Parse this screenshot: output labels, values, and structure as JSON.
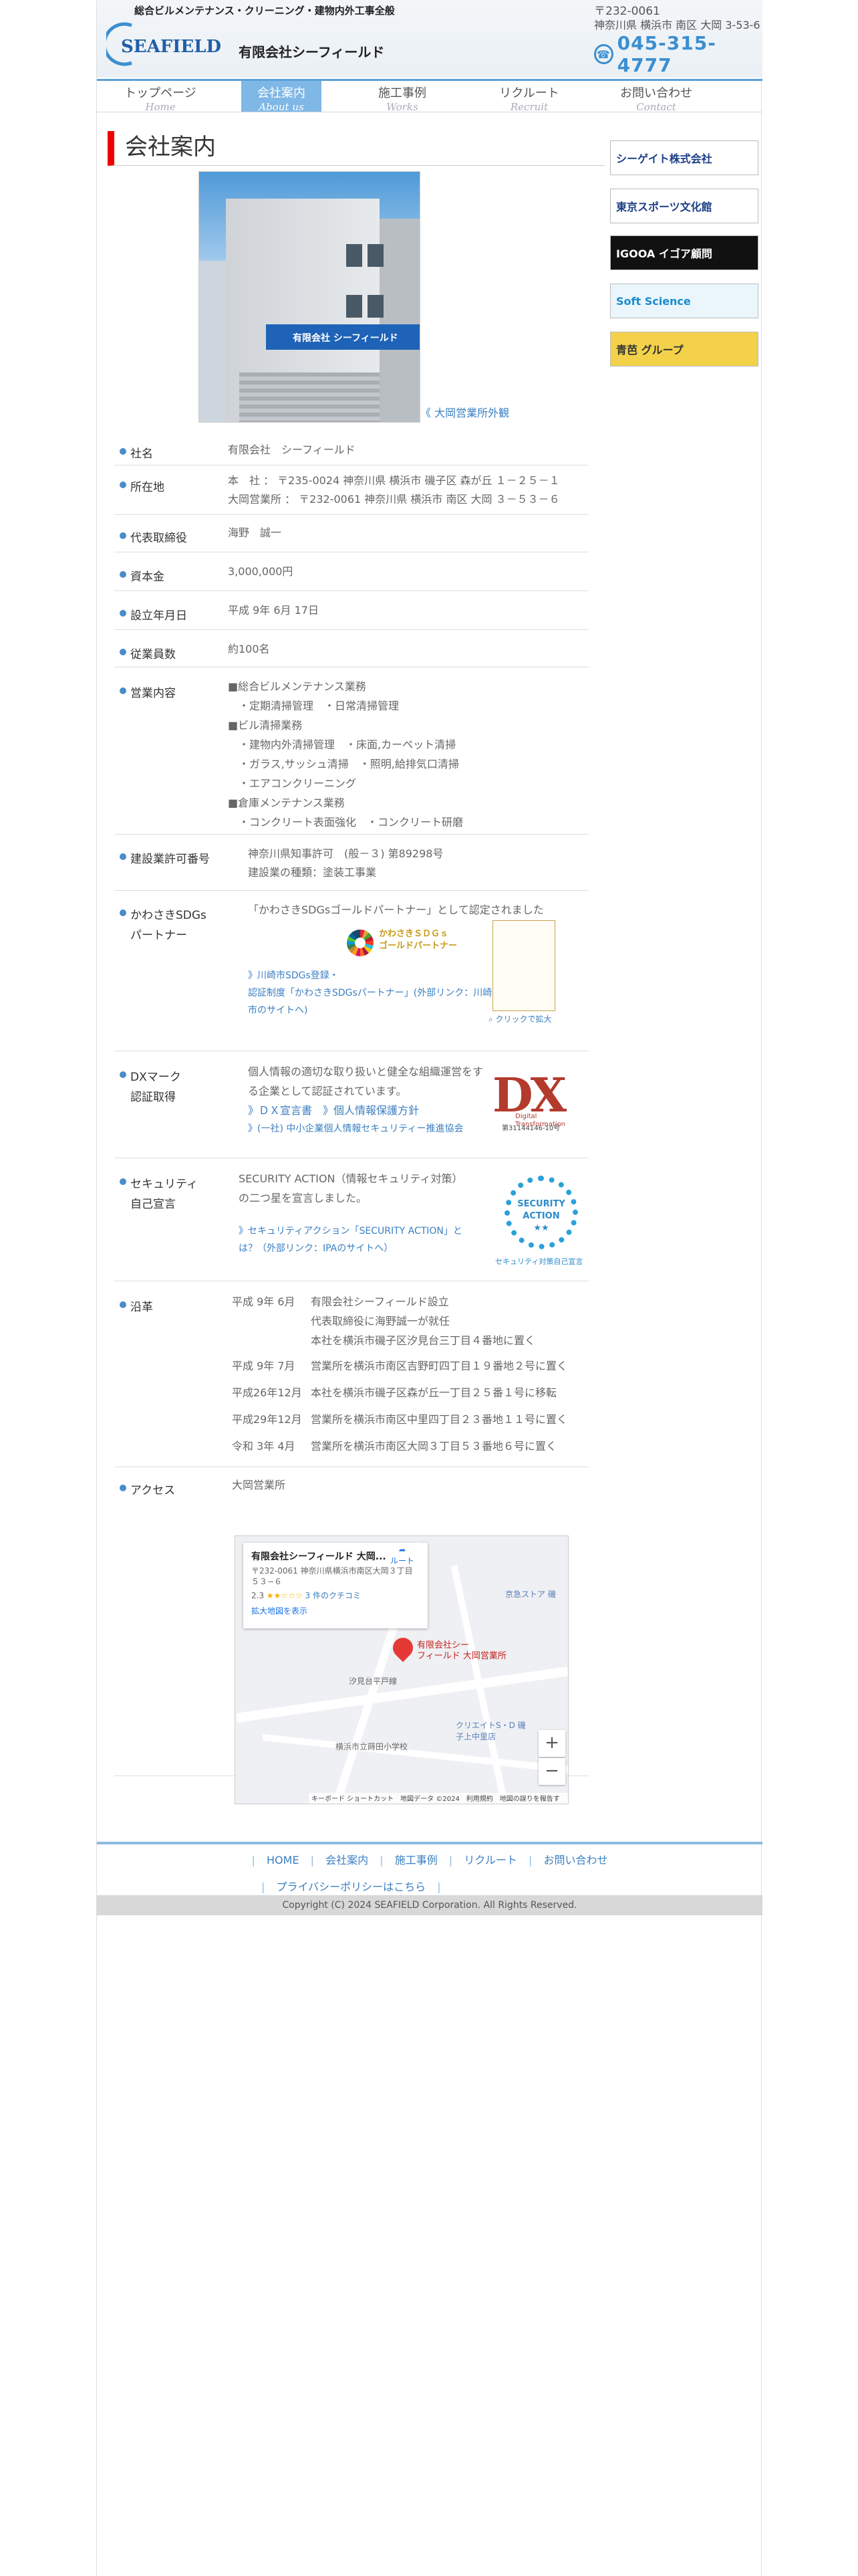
{
  "header": {
    "tagline": "総合ビルメンテナンス・クリーニング・建物内外工事全般",
    "logo_text": "SEAFIELD",
    "company_name": "有限会社シーフィールド",
    "zip": "〒232-0061",
    "address": "神奈川県 横浜市 南区 大岡 3-53-6",
    "phone": "045-315-4777"
  },
  "nav": [
    {
      "jp": "トップページ",
      "en": "Home"
    },
    {
      "jp": "会社案内",
      "en": "About us"
    },
    {
      "jp": "施工事例",
      "en": "Works"
    },
    {
      "jp": "リクルート",
      "en": "Recruit"
    },
    {
      "jp": "お問い合わせ",
      "en": "Contact"
    }
  ],
  "page_title": "会社案内",
  "building": {
    "sign_text": "有限会社 シーフィールド",
    "caption": "《 大岡営業所外観"
  },
  "info": {
    "name_label": "社名",
    "name_value": "有限会社　シーフィールド",
    "location_label": "所在地",
    "location_1": "本　社 ： 〒235-0024 神奈川県 横浜市 磯子区 森が丘 １－２５－１",
    "location_2": "大岡営業所 ： 〒232-0061 神奈川県 横浜市 南区 大岡 ３－５３－６",
    "rep_label": "代表取締役",
    "rep_value": "海野　誠一",
    "capital_label": "資本金",
    "capital_value": "3,000,000円",
    "founded_label": "設立年月日",
    "founded_value": "平成 9年 6月 17日",
    "staff_label": "従業員数",
    "staff_value": "約100名",
    "business_label": "営業内容",
    "business_lines": [
      "■総合ビルメンテナンス業務",
      "　・定期清掃管理　・日常清掃管理",
      "■ビル清掃業務",
      "　・建物内外清掃管理　・床面,カーペット清掃",
      "　・ガラス,サッシュ清掃　・照明,給排気口清掃",
      "　・エアコンクリーニング",
      "■倉庫メンテナンス業務",
      "　・コンクリート表面強化　・コンクリート研磨"
    ],
    "license_label": "建設業許可番号",
    "license_1": "神奈川県知事許可　(般－３) 第89298号",
    "license_2": "建設業の種類：塗装工事業",
    "sdgs_label_1": "かわさきSDGs",
    "sdgs_label_2": "パートナー",
    "sdgs_text": "「かわさきSDGsゴールドパートナー」として認定されました",
    "sdgs_gold_1": "かわさきＳＤＧｓ",
    "sdgs_gold_2": "ゴールドパートナー",
    "sdgs_link_1": "》川崎市SDGs登録・",
    "sdgs_link_2": "認証制度「かわさきSDGsパートナー」(外部リンク：川崎",
    "sdgs_link_3": "市のサイトへ)",
    "sdgs_cert_caption": "クリックで拡大",
    "dx_label_1": "DXマーク",
    "dx_label_2": "認証取得",
    "dx_text_1": "個人情報の適切な取り扱いと健全な組織運営をす",
    "dx_text_2": "る企業として認証されています。",
    "dx_link_1": "》ＤＸ宣言書　》個人情報保護方針",
    "dx_link_2": "》(一社) 中小企業個人情報セキュリティー推進協会",
    "dx_mark_text": "DX",
    "dx_mark_sub": "Digital Transformation",
    "dx_mark_no": "第31144146-10号",
    "sec_label_1": "セキュリティ",
    "sec_label_2": "自己宣言",
    "sec_text_1": "SECURITY ACTION（情報セキュリティ対策）",
    "sec_text_2": "の二つ星を宣言しました。",
    "sec_link_1": "》セキュリティアクション「SECURITY ACTION」と",
    "sec_link_2": "は？（外部リンク：IPAのサイトへ）",
    "sec_badge": "SECURITY ACTION",
    "sec_badge_stars": "★★",
    "sec_badge_caption": "セキュリティ対策自己宣言",
    "history_label": "沿革",
    "history": [
      {
        "date": "平成 9年 6月",
        "lines": [
          "有限会社シーフィールド設立",
          "代表取締役に海野誠一が就任",
          "本社を横浜市磯子区汐見台三丁目４番地に置く"
        ]
      },
      {
        "date": "平成 9年 7月",
        "lines": [
          "営業所を横浜市南区吉野町四丁目１９番地２号に置く"
        ]
      },
      {
        "date": "平成26年12月",
        "lines": [
          "本社を横浜市磯子区森が丘一丁目２５番１号に移転"
        ]
      },
      {
        "date": "平成29年12月",
        "lines": [
          "営業所を横浜市南区中里四丁目２３番地１１号に置く"
        ]
      },
      {
        "date": "令和 3年 4月",
        "lines": [
          "営業所を横浜市南区大岡３丁目５３番地６号に置く"
        ]
      }
    ],
    "access_label": "アクセス",
    "access_value": "大岡営業所"
  },
  "map": {
    "title": "有限会社シーフィールド 大岡...",
    "address": "〒232-0061 神奈川県横浜市南区大岡３丁目５３−６",
    "rating": "2.3",
    "stars": "★★☆☆☆",
    "reviews": "3 件のクチコミ",
    "enlarge": "拡大地図を表示",
    "route": "ルート",
    "pin_label": "有限会社シー\nフィールド 大岡営業所",
    "street": "汐見台平戸線",
    "place_1": "横浜市立蒔田小学校",
    "place_2": "クリエイトS・D 磯子上中里店",
    "place_3": "京急ストア 磯",
    "zoom_in": "+",
    "zoom_out": "−",
    "footer": "キーボード ショートカット　地図データ ©2024　利用規約　地図の誤りを報告する"
  },
  "sidebar": [
    {
      "text": "シーゲイト株式会社",
      "bg": "#ffffff",
      "color": "#1b3f86"
    },
    {
      "text": "東京スポーツ文化館",
      "bg": "#ffffff",
      "color": "#1b3f86"
    },
    {
      "text": "IGOOA イゴア顧問",
      "bg": "#111111",
      "color": "#ffffff"
    },
    {
      "text": "Soft Science",
      "bg": "#eaf6fc",
      "color": "#1a8ccf"
    },
    {
      "text": "青芭 グループ",
      "bg": "#f3d24a",
      "color": "#333333"
    }
  ],
  "footer": {
    "links": [
      "HOME",
      "会社案内",
      "施工事例",
      "リクルート",
      "お問い合わせ"
    ],
    "privacy": "プライバシーポリシーはこちら",
    "copyright": "Copyright (C) 2024 SEAFIELD Corporation. All Rights Reserved."
  },
  "colors": {
    "accent": "#3b8fd1",
    "title_bar": "#ee0000",
    "link": "#3a7fc2"
  }
}
